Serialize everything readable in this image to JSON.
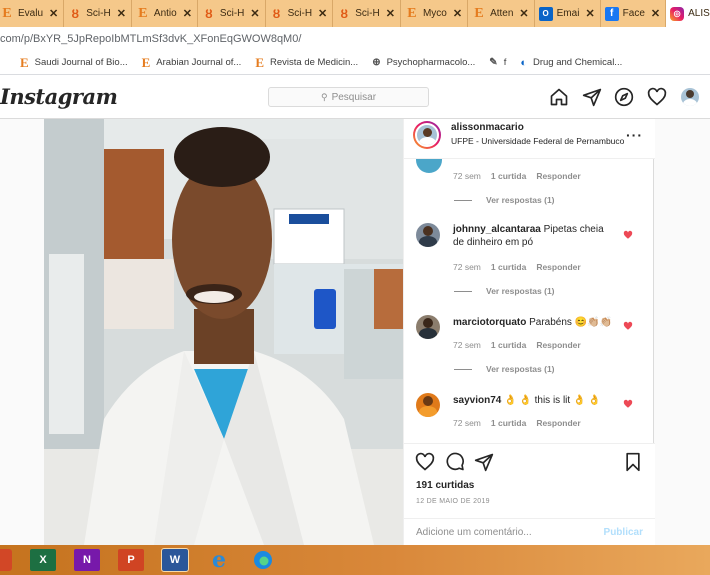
{
  "browser": {
    "tabs": [
      {
        "label": "Evalu",
        "icon": "e-icon"
      },
      {
        "label": "Sci-H",
        "icon": "scihub-icon"
      },
      {
        "label": "Antio",
        "icon": "e-icon"
      },
      {
        "label": "Sci-H",
        "icon": "scihub-icon"
      },
      {
        "label": "Sci-H",
        "icon": "scihub-icon"
      },
      {
        "label": "Sci-H",
        "icon": "scihub-icon"
      },
      {
        "label": "Myco",
        "icon": "e-icon"
      },
      {
        "label": "Atten",
        "icon": "e-icon"
      },
      {
        "label": "Emai",
        "icon": "outlook-icon"
      },
      {
        "label": "Face",
        "icon": "facebook-icon"
      },
      {
        "label": "ALIS",
        "icon": "instagram-icon"
      }
    ],
    "url": "com/p/BxYR_5JpRepoIbMTLmSf3dvK_XFonEqGWOW8qM0/",
    "bookmarks": [
      {
        "label": "Saudi Journal of Bio..."
      },
      {
        "label": "Arabian Journal of..."
      },
      {
        "label": "Revista de Medicin..."
      },
      {
        "label": "Psychopharmacolo..."
      },
      {
        "label": "f"
      },
      {
        "label": "Drug and Chemical..."
      }
    ]
  },
  "instagram": {
    "logo": "Instagram",
    "search_placeholder": "Pesquisar"
  },
  "post": {
    "author": "alissonmacario",
    "location": "UFPE - Universidade Federal de Pernambuco",
    "comments": [
      {
        "user": "",
        "text": "",
        "time": "72 sem",
        "likes": "1 curtida",
        "reply": "Responder",
        "view_replies": "Ver respostas (1)"
      },
      {
        "user": "johnny_alcantaraa",
        "text": "Pipetas cheia de dinheiro em pó",
        "time": "72 sem",
        "likes": "1 curtida",
        "reply": "Responder",
        "view_replies": "Ver respostas (1)"
      },
      {
        "user": "marciotorquato",
        "text": "Parabéns 😊👏🏼👏🏼",
        "time": "72 sem",
        "likes": "1 curtida",
        "reply": "Responder",
        "view_replies": "Ver respostas (1)"
      },
      {
        "user": "sayvion74",
        "text": "👌 👌 this is lit 👌 👌",
        "time": "72 sem",
        "likes": "1 curtida",
        "reply": "Responder",
        "view_replies": ""
      }
    ],
    "likes_count": "191 curtidas",
    "date": "12 DE MAIO DE 2019",
    "comment_placeholder": "Adicione um comentário...",
    "publish_label": "Publicar"
  },
  "colors": {
    "tab_bar": "#f5c88a",
    "like_red": "#ed4956",
    "publish_blue": "#b2dffc"
  }
}
